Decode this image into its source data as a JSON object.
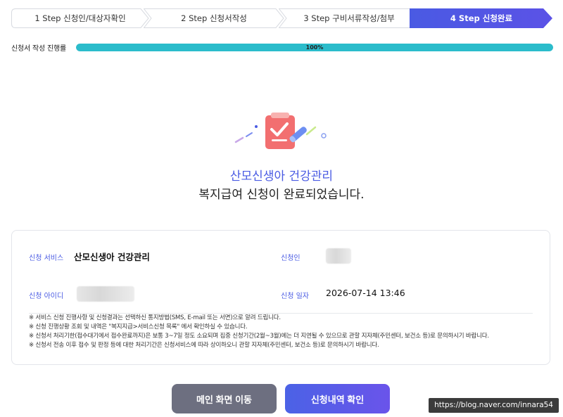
{
  "stepper": {
    "steps": [
      {
        "label": "1 Step 신청인/대상자확인",
        "active": false
      },
      {
        "label": "2 Step 신청서작성",
        "active": false
      },
      {
        "label": "3 Step 구비서류작성/첨부",
        "active": false
      },
      {
        "label": "4 Step 신청완료",
        "active": true
      }
    ],
    "active_color": "#4b5ee4"
  },
  "progress": {
    "label": "신청서 작성 진행률",
    "value_text": "100%",
    "fraction": 1.0,
    "color": "#2bbccb"
  },
  "result": {
    "service_name": "산모신생아 건강관리",
    "message": "복지급여 신청이 완료되었습니다."
  },
  "info": {
    "service_label": "신청 서비스",
    "service_value": "산모신생아 건강관리",
    "applicant_label": "신청인",
    "id_label": "신청 아이디",
    "date_label": "신청 일자",
    "date_value": "2026-07-14 13:46"
  },
  "notes": [
    "※ 서비스 신청 진행사항 및 신청결과는 선택하신 통지방법(SMS, E-mail 또는 서면)으로 알려 드립니다.",
    "※ 신청 진행상황 조회 및 내역은 \"복지지급>서비스신청 목록\" 에서 확인하실 수 있습니다.",
    "※ 신청서 처리기한(접수대기에서 접수완료까지)은 보통 3~7일 정도 소요되며 집중 신청기간(2월~3월)에는 더 지연될 수 있으므로 관할 지자체(주민센터, 보건소 등)로 문의하시기 바랍니다.",
    "※ 신청서 전송 이후 접수 및 판정 등에 대한 처리기간은 신청서비스에 따라 상이하오니 관할 지자체(주민센터, 보건소 등)로 문의하시기 바랍니다."
  ],
  "buttons": {
    "main": "메인 화면 이동",
    "history": "신청내역 확인"
  },
  "watermark": "https://blog.naver.com/innara54"
}
